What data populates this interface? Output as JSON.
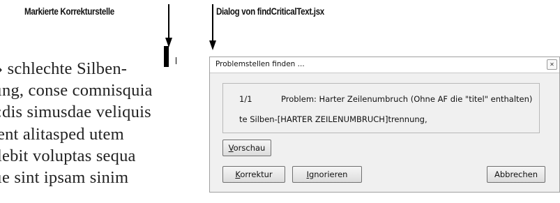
{
  "callouts": {
    "left_label": "Markierte Korrekturstelle",
    "right_label": "Dialog von findCriticalText.jsx"
  },
  "typeset_lines": [
    "› schlechte Silben-",
    "ıng, conse comnisquia",
    ":dis simusdae veliquis",
    "ent alitasped utem",
    "lebit voluptas sequa",
    "ıe sint ipsam sinim"
  ],
  "dialog": {
    "title": "Problemstellen finden ...",
    "close_glyph": "✕",
    "counter": "1/1",
    "problem_text": "Problem: Harter Zeilenumbruch (Ohne AF die \"titel\" enthalten)",
    "context_text": "te Silben-[HARTER ZEILENUMBRUCH]trennung,",
    "buttons": {
      "preview_accel": "V",
      "preview_rest": "orschau",
      "correct_accel": "K",
      "correct_rest": "orrektur",
      "ignore_accel": "I",
      "ignore_rest": "gnorieren",
      "cancel": "Abbrechen"
    }
  }
}
